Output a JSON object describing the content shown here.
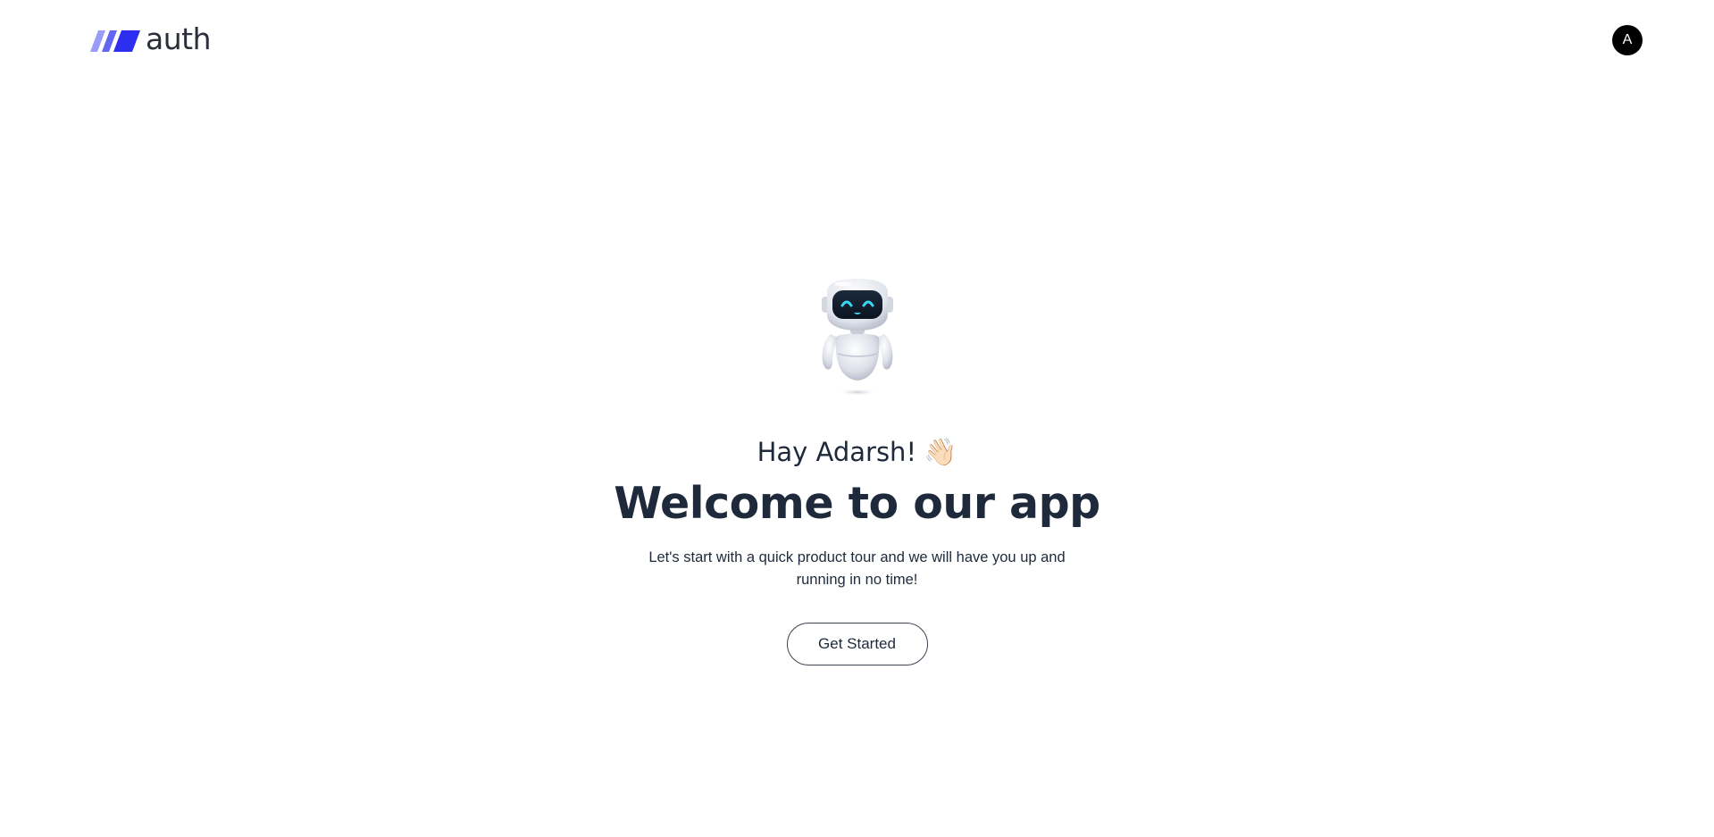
{
  "header": {
    "logo_text": "auth",
    "avatar_initial": "A"
  },
  "main": {
    "greeting": "Hay Adarsh!",
    "greeting_emoji": "👋🏻",
    "title": "Welcome to our app",
    "subtitle": "Let's start with a quick product tour and we will have you up and running in no time!",
    "cta_label": "Get Started"
  },
  "icons": {
    "logo": "auth-logo-stripes-icon",
    "robot": "robot-mascot-icon",
    "wave": "waving-hand-icon"
  },
  "colors": {
    "logo_stripe_light": "#8b8ef7",
    "logo_stripe_mid": "#5b5ff2",
    "logo_stripe_dark": "#2f2fe0",
    "text_dark": "#1e2a3b",
    "avatar_bg": "#000000",
    "robot_eye": "#3ad7f2"
  }
}
